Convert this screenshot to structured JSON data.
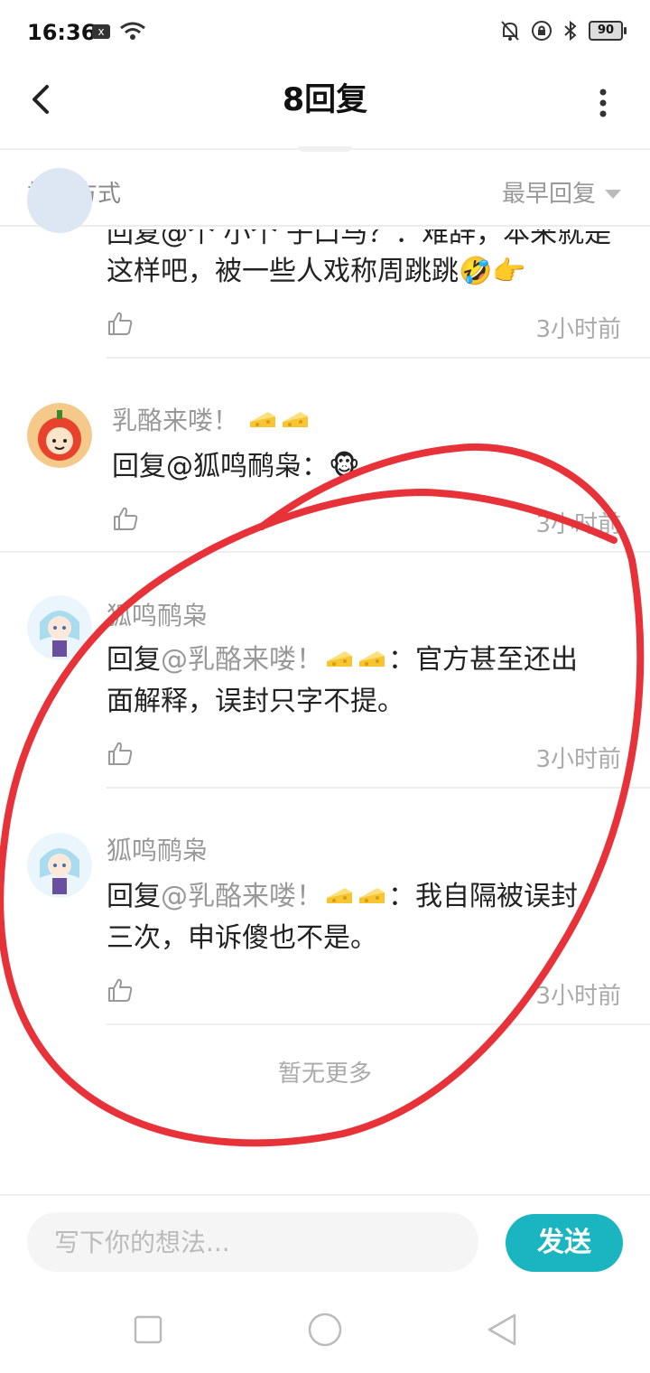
{
  "status_bar": {
    "time": "16:36",
    "msg_icon": "x",
    "battery": "90"
  },
  "header": {
    "title": "8回复"
  },
  "sort": {
    "label": "排序方式",
    "selected": "最早回复"
  },
  "comments": [
    {
      "text_line1": "回复@个 小个 子口马？：难辞，本来就是",
      "text_line2": "这样吧，被一些人戏称周跳跳🤣👉",
      "time": "3小时前"
    },
    {
      "username": "乳酪来喽！",
      "reply_prefix": "回复@狐鸣鸸枭：",
      "reply_emoji": "🐵",
      "time": "3小时前"
    },
    {
      "username": "狐鸣鸸枭",
      "reply_prefix": "回复",
      "reply_at": "@乳酪来喽！",
      "reply_line1_rest": "：官方甚至还出",
      "reply_line2": "面解释，误封只字不提。",
      "time": "3小时前"
    },
    {
      "username": "狐鸣鸸枭",
      "reply_prefix": "回复",
      "reply_at": "@乳酪来喽！",
      "reply_line1_rest": "：我自隔被误封",
      "reply_line2": "三次，申诉傻也不是。",
      "time": "3小时前"
    }
  ],
  "footer": {
    "no_more": "暂无更多"
  },
  "input": {
    "placeholder": "写下你的想法...",
    "value": "",
    "send_label": "发送"
  },
  "colors": {
    "accent": "#1ab5c0",
    "annotation": "#e8323a"
  }
}
